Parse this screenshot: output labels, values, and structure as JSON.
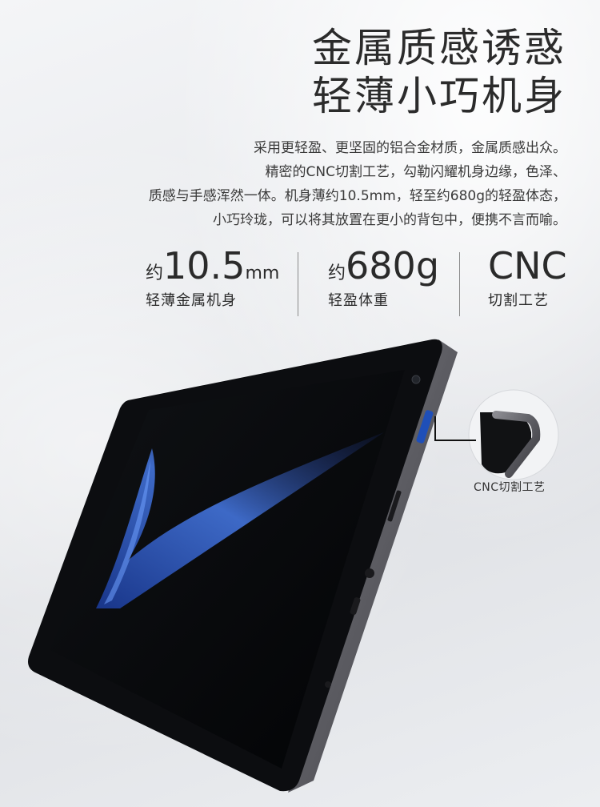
{
  "headline": {
    "line1": "金属质感诱惑",
    "line2": "轻薄小巧机身"
  },
  "description": {
    "line1": "采用更轻盈、更坚固的铝合金材质，金属质感出众。",
    "line2": "精密的CNC切割工艺，勾勒闪耀机身边缘，色泽、",
    "line3": "质感与手感浑然一体。机身薄约10.5mm，轻至约680g的轻盈体态，",
    "line4": "小巧玲珑，可以将其放置在更小的背包中，便携不言而喻。"
  },
  "stats": [
    {
      "prefix": "约",
      "value": "10.5",
      "unit": "mm",
      "label": "轻薄金属机身"
    },
    {
      "prefix": "约",
      "value": "680g",
      "unit": "",
      "label": "轻盈体重"
    },
    {
      "prefix": "",
      "value": "CNC",
      "unit": "",
      "label": "切割工艺"
    }
  ],
  "callout": {
    "label": "CNC切割工艺"
  },
  "colors": {
    "text": "#2a2a2a",
    "frame": "#6b6b70",
    "screen": "#050609",
    "wave": "#2f63d6"
  }
}
